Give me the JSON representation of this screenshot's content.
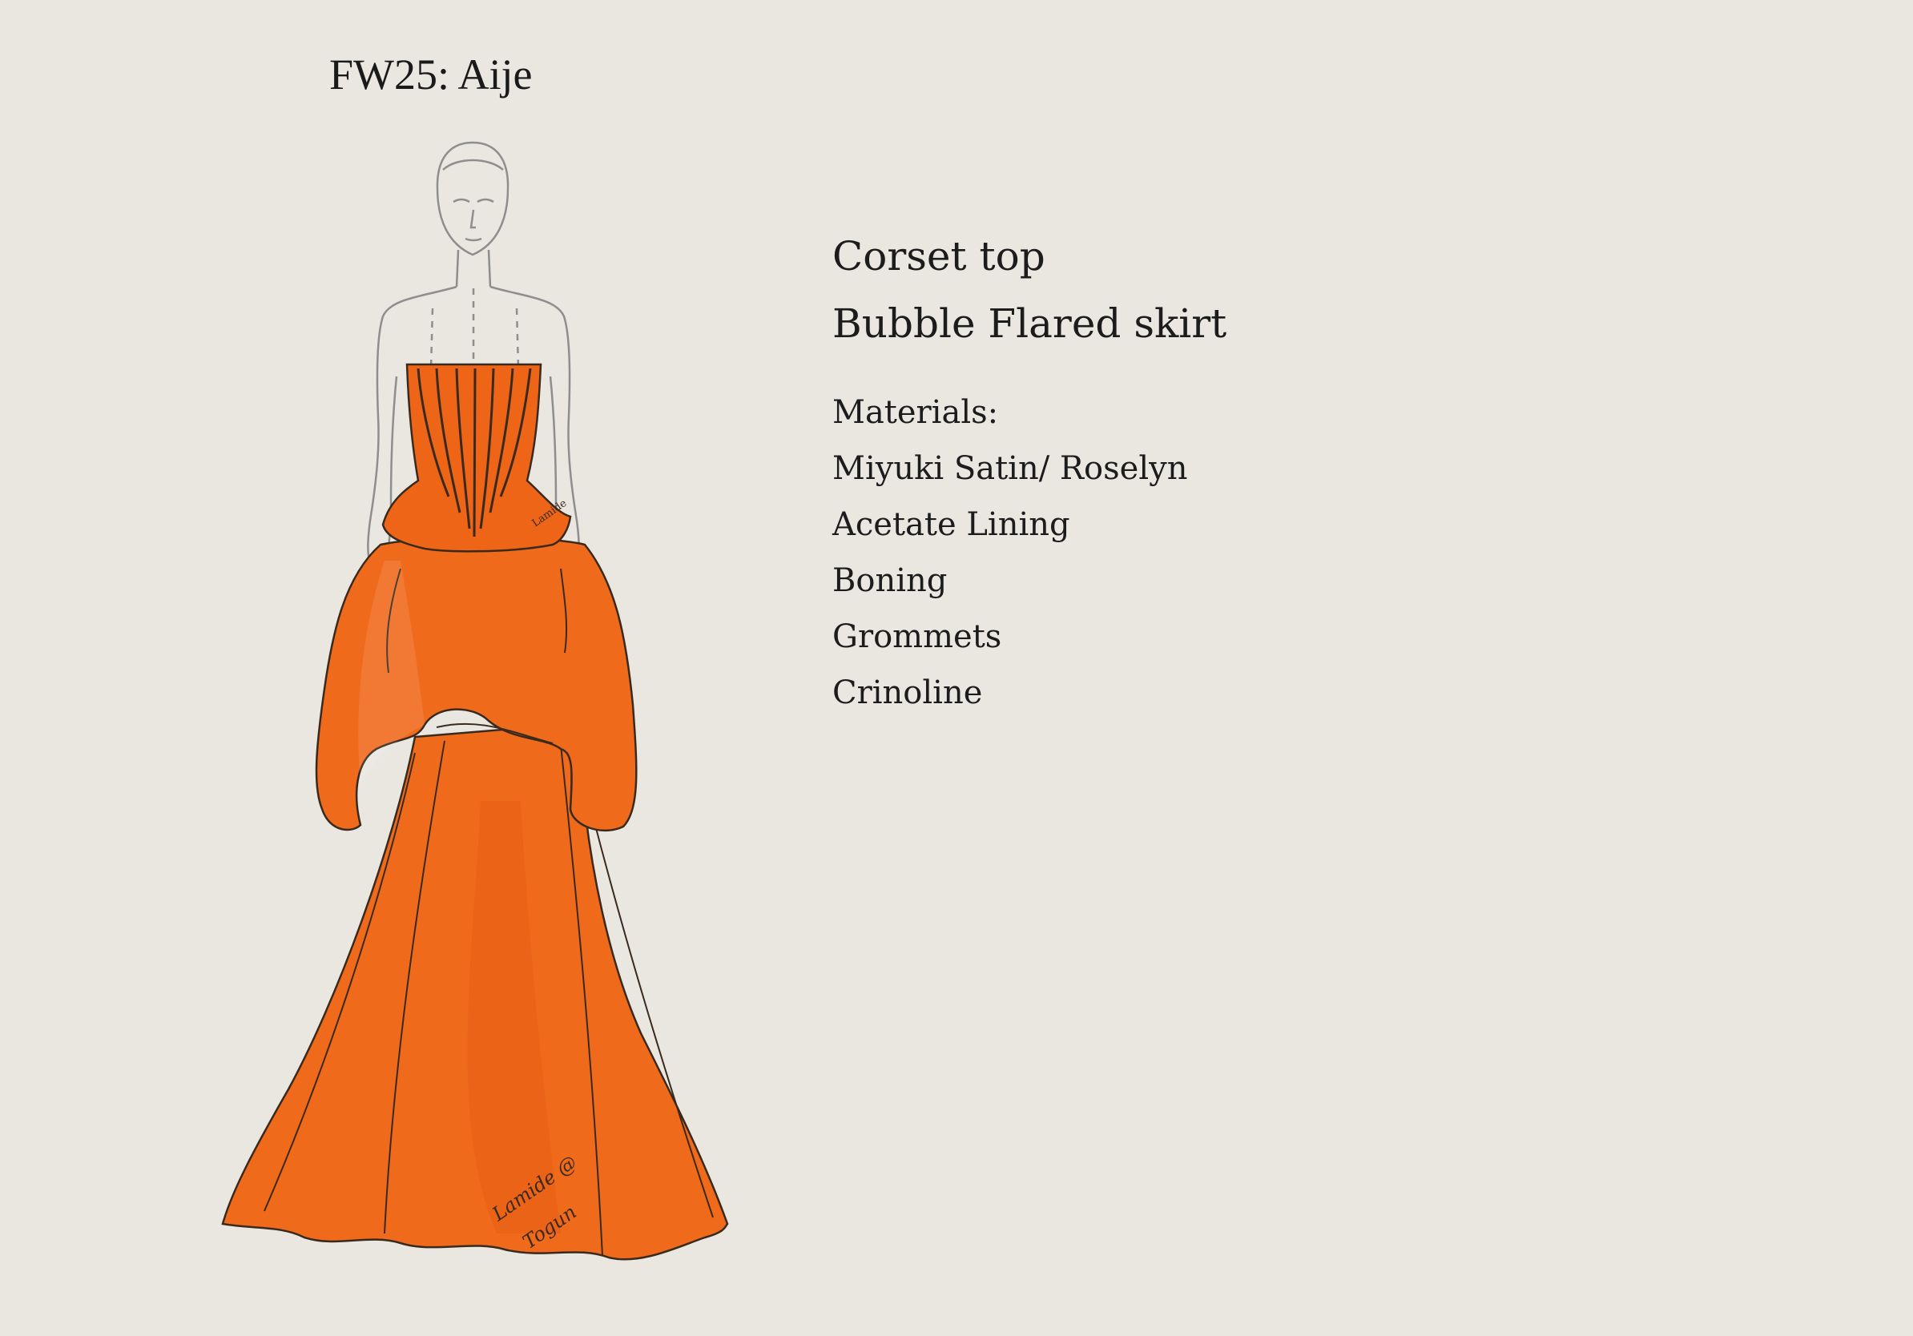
{
  "title": "FW25: Aije",
  "garment": {
    "pieces": [
      "Corset top",
      "Bubble Flared skirt"
    ]
  },
  "materials": {
    "heading": "Materials:",
    "items": [
      "Miyuki Satin/ Roselyn",
      "Acetate Lining",
      "Boning",
      "Grommets",
      "Crinoline"
    ]
  },
  "signature": "Lamide @ Togun",
  "colors": {
    "background": "#e9e7e0",
    "dress": "#f06a1c",
    "dress_shadow": "#e0560f",
    "outline": "#3a2a1e",
    "croquis": "#8e8e8e"
  }
}
